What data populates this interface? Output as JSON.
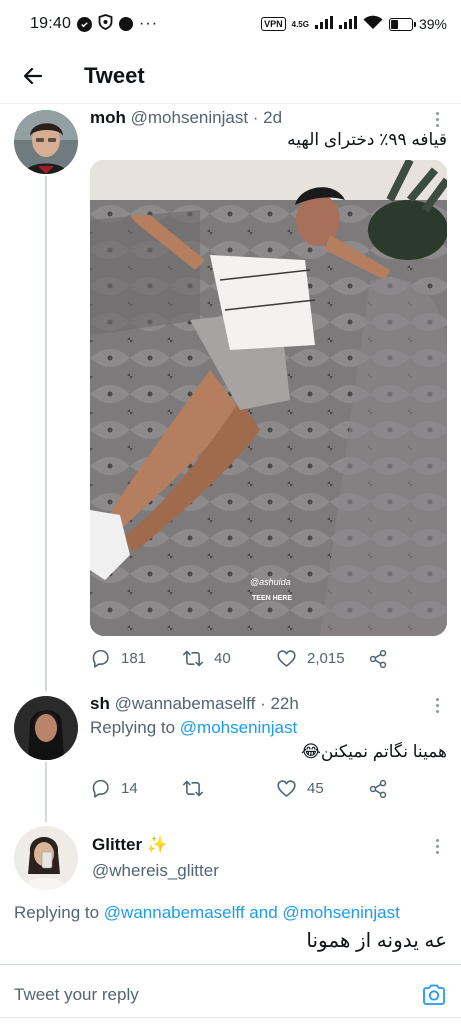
{
  "status_bar": {
    "time": "19:40",
    "vpn": "VPN",
    "network": "4.5G",
    "battery": "39%"
  },
  "header": {
    "title": "Tweet"
  },
  "tweets": [
    {
      "name": "moh",
      "handle": "@mohseninjast",
      "time": "· 2d",
      "text": "قیافه ۹۹٪ دخترای الهیه",
      "image_watermark": "@ashuida",
      "image_watermark_2": "TEEN HERE",
      "replies": "181",
      "retweets": "40",
      "likes": "2,015"
    },
    {
      "name": "sh",
      "handle": "@wannabemaselff",
      "time": "· 22h",
      "replying_prefix": "Replying to",
      "replying_to": "@mohseninjast",
      "text": "همینا نگاتم نمیکنن😂",
      "replies": "14",
      "retweets": "",
      "likes": "45"
    },
    {
      "name": "Glitter",
      "emoji": "✨",
      "handle": "@whereis_glitter",
      "replying_prefix": "Replying to",
      "replying_to_1": "@wannabemaselff",
      "replying_and": "and",
      "replying_to_2": "@mohseninjast",
      "text": "عه یدونه از همونا"
    }
  ],
  "reply_bar": {
    "placeholder": "Tweet your reply"
  },
  "colors": {
    "link": "#1d9bf0",
    "secondary": "#536471",
    "line": "#cfd9de"
  }
}
